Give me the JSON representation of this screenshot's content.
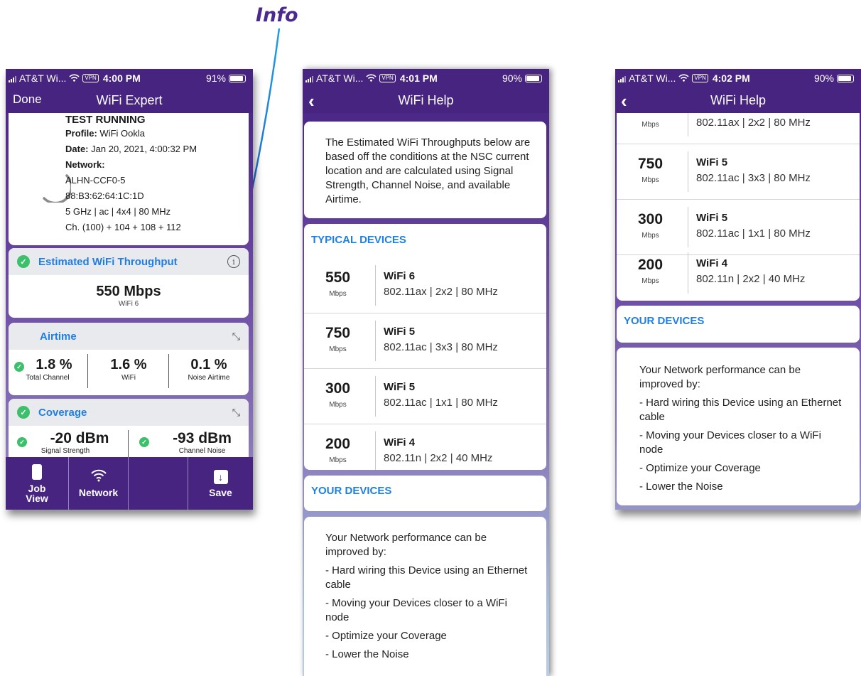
{
  "annotation": {
    "label": "Info"
  },
  "colors": {
    "brand_purple": "#47247f",
    "accent_blue": "#1f7fe3",
    "ok_green": "#3cc06b"
  },
  "screen1": {
    "status": {
      "carrier": "AT&T Wi...",
      "vpn": "VPN",
      "time": "4:00 PM",
      "battery": "91%",
      "battery_level": 0.91
    },
    "nav": {
      "left": "Done",
      "title": "WiFi Expert"
    },
    "test": {
      "title": "TEST RUNNING",
      "profile_label": "Profile:",
      "profile_value": "WiFi Ookla",
      "date_label": "Date:",
      "date_value": "Jan 20, 2021, 4:00:32 PM",
      "network_label": "Network:",
      "lines": [
        "ALHN-CCF0-5",
        "88:B3:62:64:1C:1D",
        "5 GHz | ac | 4x4 | 80 MHz",
        "Ch. (100) + 104 + 108 + 112"
      ]
    },
    "throughput": {
      "title": "Estimated WiFi Throughput",
      "value": "550 Mbps",
      "sub": "WiFi 6"
    },
    "airtime": {
      "title": "Airtime",
      "cells": [
        {
          "value": "1.8 %",
          "label": "Total Channel"
        },
        {
          "value": "1.6 %",
          "label": "WiFi"
        },
        {
          "value": "0.1 %",
          "label": "Noise Airtime"
        }
      ]
    },
    "coverage": {
      "title": "Coverage",
      "cells": [
        {
          "value": "-20 dBm",
          "label": "Signal Strength"
        },
        {
          "value": "-93 dBm",
          "label": "Channel Noise"
        }
      ]
    },
    "tabs": {
      "job_line1": "Job",
      "job_line2": "View",
      "network": "Network",
      "save": "Save"
    }
  },
  "screen2": {
    "status": {
      "carrier": "AT&T Wi...",
      "vpn": "VPN",
      "time": "4:01 PM",
      "battery": "90%",
      "battery_level": 0.9
    },
    "nav": {
      "title": "WiFi Help"
    },
    "intro": "The Estimated WiFi Throughputs below are based off the conditions at the NSC current location and are calculated using Signal Strength, Channel Noise, and available Airtime.",
    "typical_title": "TYPICAL DEVICES",
    "devices": [
      {
        "speed": "550",
        "unit": "Mbps",
        "gen": "WiFi 6",
        "spec": "802.11ax | 2x2 | 80 MHz"
      },
      {
        "speed": "750",
        "unit": "Mbps",
        "gen": "WiFi 5",
        "spec": "802.11ac | 3x3 | 80 MHz"
      },
      {
        "speed": "300",
        "unit": "Mbps",
        "gen": "WiFi 5",
        "spec": "802.11ac | 1x1 | 80 MHz"
      },
      {
        "speed": "200",
        "unit": "Mbps",
        "gen": "WiFi 4",
        "spec": "802.11n | 2x2 | 40 MHz"
      }
    ],
    "your_devices_title": "YOUR DEVICES",
    "improve": {
      "intro": "Your Network performance can be improved by:",
      "items": [
        "- Hard wiring this Device using an Ethernet cable",
        "- Moving your Devices closer to a WiFi node",
        "- Optimize your Coverage",
        "- Lower the Noise"
      ]
    }
  },
  "screen3": {
    "status": {
      "carrier": "AT&T Wi...",
      "vpn": "VPN",
      "time": "4:02 PM",
      "battery": "90%",
      "battery_level": 0.9
    },
    "nav": {
      "title": "WiFi Help"
    },
    "partial_row": {
      "unit": "Mbps",
      "spec": "802.11ax | 2x2 | 80 MHz"
    },
    "devices": [
      {
        "speed": "750",
        "unit": "Mbps",
        "gen": "WiFi 5",
        "spec": "802.11ac | 3x3 | 80 MHz"
      },
      {
        "speed": "300",
        "unit": "Mbps",
        "gen": "WiFi 5",
        "spec": "802.11ac | 1x1 | 80 MHz"
      },
      {
        "speed": "200",
        "unit": "Mbps",
        "gen": "WiFi 4",
        "spec": "802.11n | 2x2 | 40 MHz"
      }
    ],
    "your_devices_title": "YOUR DEVICES",
    "improve": {
      "intro": "Your Network performance can be improved by:",
      "items": [
        "- Hard wiring this Device using an Ethernet cable",
        "- Moving your Devices closer to a WiFi node",
        "- Optimize your Coverage",
        "- Lower the Noise"
      ]
    }
  }
}
